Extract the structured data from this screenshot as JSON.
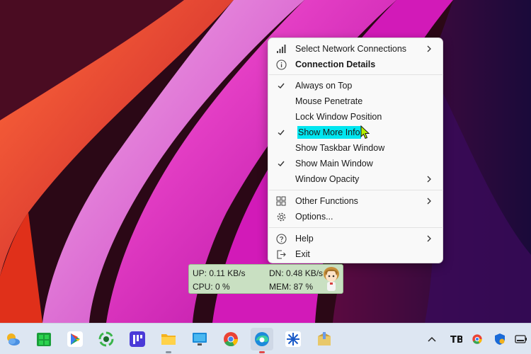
{
  "menu": {
    "items": [
      {
        "label": "Select Network Connections",
        "icon": "signal-bars-icon",
        "submenu": true
      },
      {
        "label": "Connection Details",
        "icon": "info-icon"
      },
      {
        "label": "Always on Top",
        "checked": true
      },
      {
        "label": "Mouse Penetrate"
      },
      {
        "label": "Lock Window Position"
      },
      {
        "label": "Show More Info",
        "checked": true,
        "highlighted": true
      },
      {
        "label": "Show Taskbar Window"
      },
      {
        "label": "Show Main Window",
        "checked": true
      },
      {
        "label": "Window Opacity",
        "submenu": true
      },
      {
        "label": "Other Functions",
        "icon": "grid-icon",
        "submenu": true
      },
      {
        "label": "Options...",
        "icon": "gear-icon"
      },
      {
        "label": "Help",
        "icon": "help-icon",
        "submenu": true
      },
      {
        "label": "Exit",
        "icon": "exit-icon"
      }
    ]
  },
  "widget": {
    "up": "UP: 0.11 KB/s",
    "dn": "DN: 0.48 KB/s",
    "cpu": "CPU: 0 %",
    "mem": "MEM: 87 %"
  },
  "taskbar": {
    "apps": [
      "weather-icon",
      "store-icon",
      "play-store-icon",
      "sync-icon",
      "linear-icon",
      "file-explorer-icon",
      "monitor-icon",
      "chrome-icon",
      "edge-icon",
      "snowflake-icon",
      "installer-icon"
    ],
    "tray": [
      "chevron-up-icon",
      "tb-icon",
      "chrome-small-icon",
      "defender-icon",
      "battery-icon"
    ]
  },
  "colors": {
    "menu_bg": "#f9f9f9",
    "highlight": "#00e6f0",
    "widget_bg": "#c9e0c2",
    "taskbar_bg": "#dde6f2"
  }
}
